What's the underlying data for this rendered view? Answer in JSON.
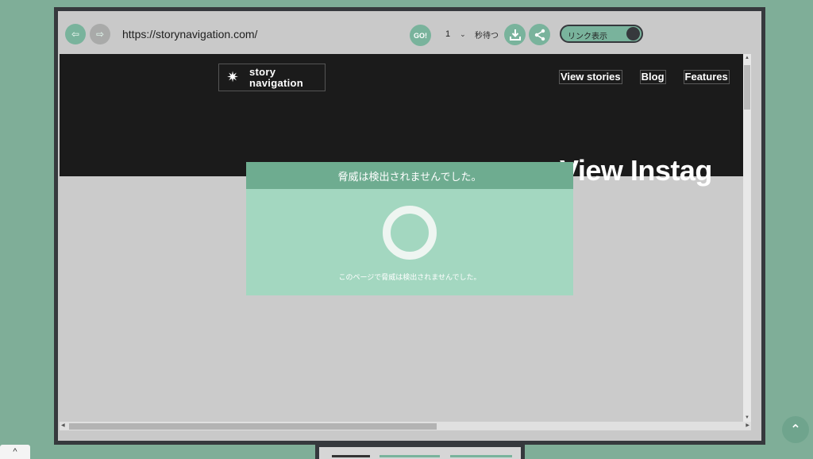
{
  "toolbar": {
    "back_icon": "arrow-left-icon",
    "forward_icon": "arrow-right-icon",
    "back_glyph": "⇦",
    "forward_glyph": "⇨",
    "url": "https://storynavigation.com/",
    "go_label": "GO!",
    "wait_value": "1",
    "wait_label": "秒待つ",
    "download_icon": "download-icon",
    "share_icon": "share-icon",
    "toggle_label": "リンク表示",
    "accent_color": "#79b39c"
  },
  "site": {
    "logo_star": "✷",
    "logo_line1": "story",
    "logo_line2": "navigation",
    "nav": [
      "View stories",
      "Blog",
      "Features"
    ],
    "hero_title": "View Instag"
  },
  "scan_dialog": {
    "title": "脅威は検出されませんでした。",
    "message": "このページで脅威は検出されませんでした。",
    "header_color": "#6eac90",
    "body_color": "#a3d7c0"
  },
  "footer": {
    "corner_glyph": "^",
    "scroll_top_glyph": "⌃"
  }
}
